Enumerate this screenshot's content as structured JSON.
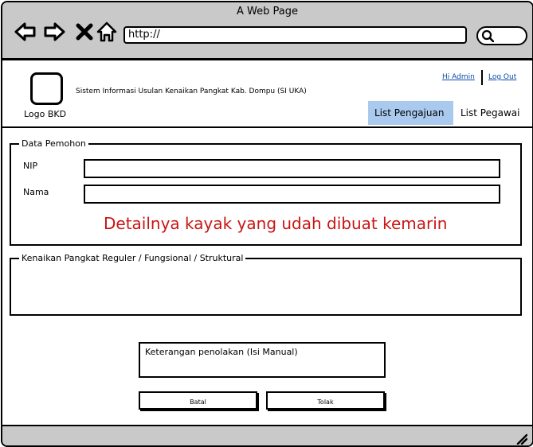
{
  "window": {
    "title": "A Web Page"
  },
  "browser": {
    "url": "http://",
    "icons": [
      "back-arrow-icon",
      "forward-arrow-icon",
      "close-x-icon",
      "home-icon",
      "search-icon"
    ]
  },
  "header": {
    "logo_label": "Logo BKD",
    "app_title": "Sistem Informasi Usulan Kenaikan Pangkat Kab. Dompu (SI UKA)",
    "greeting_link": "Hi Admin",
    "logout_link": "Log Out",
    "tabs": [
      {
        "label": "List Pengajuan",
        "active": true
      },
      {
        "label": "List Pegawai",
        "active": false
      }
    ]
  },
  "applicant": {
    "legend": "Data Pemohon",
    "nip_label": "NIP",
    "nip_value": "",
    "nama_label": "Nama",
    "nama_value": "",
    "note": "Detailnya kayak yang udah dibuat kemarin"
  },
  "promotion": {
    "legend": "Kenaikan Pangkat Reguler / Fungsional / Struktural"
  },
  "rejection": {
    "placeholder": "Keterangan penolakan (Isi Manual)"
  },
  "buttons": {
    "cancel_label": "Batal",
    "reject_label": "Tolak"
  },
  "colors": {
    "chrome": "#c9c9c9",
    "active_tab": "#a9c9ee",
    "note": "#c81515",
    "link": "#0b4aa8"
  }
}
